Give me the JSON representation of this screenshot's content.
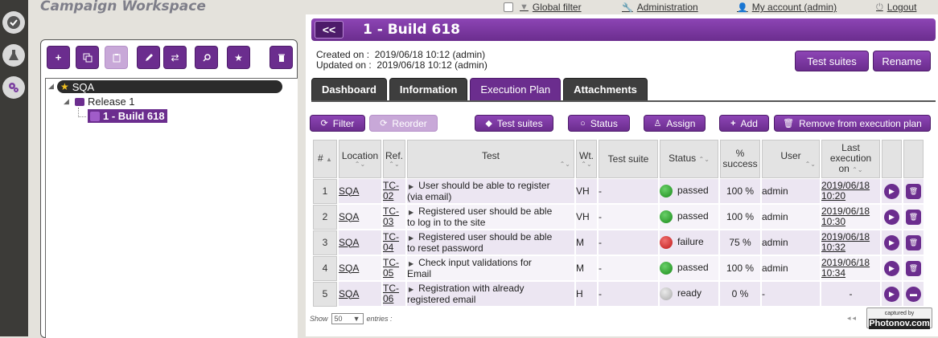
{
  "left": {
    "workspace_title": "Campaign Workspace",
    "tree": {
      "root_label": "SQA",
      "release_label": "Release 1",
      "build_label": "1 - Build 618"
    }
  },
  "topbar": {
    "global_filter": "Global filter",
    "administration": "Administration",
    "my_account": "My account (admin)",
    "logout": "Logout"
  },
  "header": {
    "back_label": "<<",
    "title": "1 - Build 618"
  },
  "meta": {
    "created_label": "Created on :",
    "created_value": "2019/06/18 10:12 (admin)",
    "updated_label": "Updated on :",
    "updated_value": "2019/06/18 10:12 (admin)"
  },
  "buttons": {
    "test_suites": "Test suites",
    "rename": "Rename"
  },
  "tabs": [
    "Dashboard",
    "Information",
    "Execution Plan",
    "Attachments"
  ],
  "actions": {
    "filter": "Filter",
    "reorder": "Reorder",
    "test_suites": "Test suites",
    "status": "Status",
    "assign": "Assign",
    "add": "Add",
    "remove": "Remove from execution plan"
  },
  "table": {
    "headers": {
      "num": "#",
      "location": "Location",
      "ref": "Ref.",
      "test": "Test",
      "wt": "Wt.",
      "suite": "Test suite",
      "status": "Status",
      "success_1": "%",
      "success_2": "success",
      "user": "User",
      "last_1": "Last",
      "last_2": "execution",
      "last_3": "on"
    },
    "rows": [
      {
        "num": "1",
        "location": "SQA",
        "ref_1": "TC-",
        "ref_2": "02",
        "test_1": "User should be able to register",
        "test_2": "(via email)",
        "wt": "VH",
        "suite": "-",
        "status": "passed",
        "status_color": "green",
        "success": "100 %",
        "user": "admin",
        "last_1": "2019/06/18",
        "last_2": "10:20"
      },
      {
        "num": "2",
        "location": "SQA",
        "ref_1": "TC-",
        "ref_2": "03",
        "test_1": "Registered user should be able",
        "test_2": "to log in to the site",
        "wt": "VH",
        "suite": "-",
        "status": "passed",
        "status_color": "green",
        "success": "100 %",
        "user": "admin",
        "last_1": "2019/06/18",
        "last_2": "10:30"
      },
      {
        "num": "3",
        "location": "SQA",
        "ref_1": "TC-",
        "ref_2": "04",
        "test_1": "Registered user should be able",
        "test_2": "to reset password",
        "wt": "M",
        "suite": "-",
        "status": "failure",
        "status_color": "red",
        "success": "75 %",
        "user": "admin",
        "last_1": "2019/06/18",
        "last_2": "10:32"
      },
      {
        "num": "4",
        "location": "SQA",
        "ref_1": "TC-",
        "ref_2": "05",
        "test_1": "Check input validations for",
        "test_2": "Email",
        "wt": "M",
        "suite": "-",
        "status": "passed",
        "status_color": "green",
        "success": "100 %",
        "user": "admin",
        "last_1": "2019/06/18",
        "last_2": "10:34"
      },
      {
        "num": "5",
        "location": "SQA",
        "ref_1": "TC-",
        "ref_2": "06",
        "test_1": "Registration with already",
        "test_2": "registered email",
        "wt": "H",
        "suite": "-",
        "status": "ready",
        "status_color": "grey",
        "success": "0 %",
        "user": "-",
        "last_1": "-",
        "last_2": ""
      }
    ]
  },
  "footer": {
    "show": "Show",
    "page_size": "50",
    "entries": "entries :"
  },
  "watermark": {
    "line1": "captured by",
    "line2": "Photonov.com"
  },
  "colors": {
    "accent": "#6b2d8e",
    "passed": "#2e9e2e",
    "failure": "#d02020",
    "ready": "#bbbbbb"
  }
}
